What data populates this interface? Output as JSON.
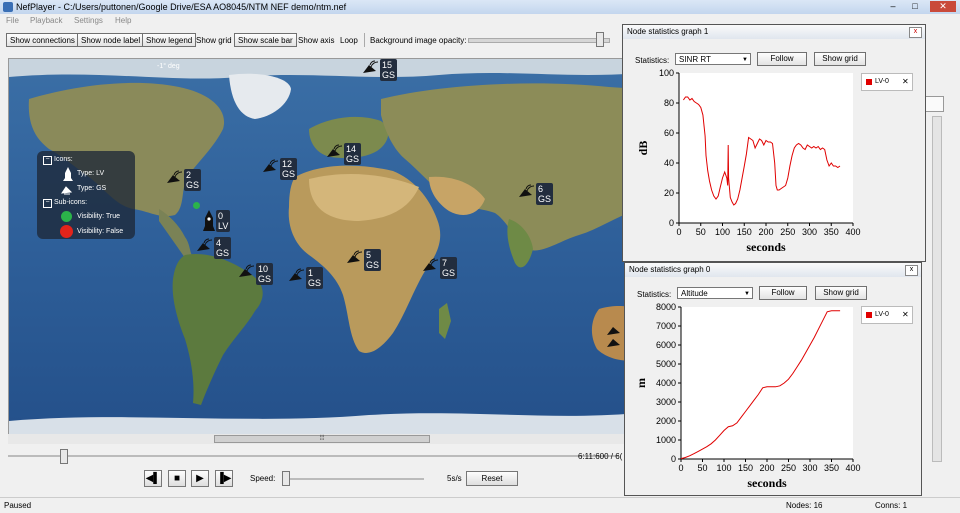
{
  "window": {
    "title": "NefPlayer - C:/Users/puttonen/Google Drive/ESA AO8045/NTM NEF demo/ntm.nef",
    "minimize": "–",
    "maximize": "□",
    "close": "✕"
  },
  "menu": [
    "File",
    "Playback",
    "Settings",
    "Help"
  ],
  "toolbar": {
    "show_connections": "Show connections",
    "show_node_label": "Show node label",
    "show_legend": "Show legend",
    "show_grid": "Show grid",
    "show_scale_bar": "Show scale bar",
    "show_axis": "Show axis",
    "loop": "Loop",
    "bg_opacity": "Background image opacity:",
    "bg_opacity_value": 0.96
  },
  "map": {
    "degree_label": "-1° deg",
    "legend": {
      "icons": "Icons:",
      "type_lv": "Type: LV",
      "type_gs": "Type: GS",
      "subicons": "Sub-icons:",
      "vis_true": "Visibility: True",
      "vis_false": "Visibility: False",
      "collapse": "−"
    },
    "nodes": [
      {
        "id": "15",
        "type": "GS"
      },
      {
        "id": "2",
        "type": "GS"
      },
      {
        "id": "12",
        "type": "GS"
      },
      {
        "id": "14",
        "type": "GS"
      },
      {
        "id": "6",
        "type": "GS"
      },
      {
        "id": "0",
        "type": "LV"
      },
      {
        "id": "4",
        "type": "GS"
      },
      {
        "id": "10",
        "type": "GS"
      },
      {
        "id": "1",
        "type": "GS"
      },
      {
        "id": "5",
        "type": "GS"
      },
      {
        "id": "7",
        "type": "GS"
      }
    ],
    "hscroll_grip": "⦙⦙⦙"
  },
  "playback": {
    "time": "6:11:600 / 6(",
    "timeline_position": 0.09,
    "speed_label": "Speed:",
    "speed_value": "5s/s",
    "reset": "Reset",
    "btn_back": "◀▌",
    "btn_stop": "■",
    "btn_play": "▶",
    "btn_forward": "▐▶"
  },
  "status": {
    "state": "Paused",
    "nodes": "Nodes: 16",
    "conns": "Conns: 1"
  },
  "graph1": {
    "title": "Node statistics graph 1",
    "close": "x",
    "statistics_label": "Statistics:",
    "statistic": "SINR RT",
    "follow": "Follow",
    "show_grid": "Show grid",
    "series_name": "LV-0",
    "series_remove": "✕",
    "series_color": "#e00000",
    "chart_data": {
      "type": "line",
      "xlabel": "seconds",
      "ylabel": "dB",
      "xlim": [
        0,
        400
      ],
      "ylim": [
        0,
        100
      ],
      "xticks": [
        0,
        50,
        100,
        150,
        200,
        250,
        300,
        350,
        400
      ],
      "yticks": [
        0,
        20,
        40,
        60,
        80,
        100
      ],
      "series": [
        {
          "name": "LV-0",
          "x": [
            10,
            15,
            20,
            25,
            30,
            35,
            40,
            45,
            50,
            55,
            60,
            62,
            66,
            70,
            75,
            80,
            85,
            90,
            95,
            100,
            105,
            110,
            112,
            113,
            114,
            118,
            122,
            126,
            130,
            135,
            140,
            145,
            150,
            155,
            160,
            165,
            170,
            175,
            180,
            185,
            190,
            195,
            200,
            205,
            210,
            215,
            220,
            223,
            226,
            230,
            235,
            240,
            245,
            250,
            255,
            260,
            265,
            270,
            275,
            280,
            285,
            290,
            295,
            300,
            305,
            310,
            315,
            320,
            325,
            330,
            335,
            340,
            345,
            350,
            355,
            360,
            365,
            370
          ],
          "y": [
            82,
            84,
            84,
            82,
            83,
            81,
            80,
            79,
            77,
            72,
            58,
            45,
            35,
            28,
            22,
            18,
            16,
            18,
            24,
            30,
            34,
            30,
            25,
            52,
            30,
            17,
            14,
            12,
            13,
            16,
            22,
            30,
            38,
            46,
            57,
            56,
            55,
            50,
            53,
            56,
            55,
            52,
            55,
            54,
            54,
            53,
            40,
            25,
            22,
            22,
            23,
            24,
            25,
            30,
            38,
            45,
            50,
            52,
            53,
            52,
            50,
            49,
            52,
            51,
            50,
            51,
            50,
            51,
            49,
            50,
            49,
            42,
            38,
            40,
            38,
            38,
            37,
            38
          ]
        }
      ]
    }
  },
  "graph0": {
    "title": "Node statistics graph 0",
    "close": "x",
    "statistics_label": "Statistics:",
    "statistic": "Altitude",
    "follow": "Follow",
    "show_grid": "Show grid",
    "series_name": "LV-0",
    "series_remove": "✕",
    "series_color": "#e00000",
    "chart_data": {
      "type": "line",
      "xlabel": "seconds",
      "ylabel": "m",
      "xlim": [
        0,
        400
      ],
      "ylim": [
        0,
        8000
      ],
      "xticks": [
        0,
        50,
        100,
        150,
        200,
        250,
        300,
        350,
        400
      ],
      "yticks": [
        0,
        1000,
        2000,
        3000,
        4000,
        5000,
        6000,
        7000,
        8000
      ],
      "series": [
        {
          "name": "LV-0",
          "x": [
            0,
            10,
            20,
            30,
            40,
            50,
            60,
            70,
            80,
            90,
            100,
            110,
            120,
            130,
            140,
            150,
            160,
            170,
            180,
            190,
            200,
            210,
            220,
            230,
            240,
            250,
            260,
            270,
            280,
            290,
            300,
            310,
            320,
            330,
            340,
            350,
            360,
            370
          ],
          "y": [
            20,
            80,
            170,
            280,
            400,
            520,
            650,
            800,
            1000,
            1250,
            1500,
            1700,
            1750,
            1900,
            2200,
            2500,
            2800,
            3100,
            3400,
            3750,
            3800,
            3800,
            3800,
            3850,
            4000,
            4200,
            4500,
            4850,
            5200,
            5600,
            6000,
            6400,
            6850,
            7300,
            7750,
            7800,
            7800,
            7800
          ]
        }
      ]
    }
  },
  "colors": {
    "ocean": "#2e5f99",
    "badge": "#222d3e",
    "visibility_true": "#2bb34a",
    "visibility_false": "#e3241b",
    "series": "#e00000"
  }
}
